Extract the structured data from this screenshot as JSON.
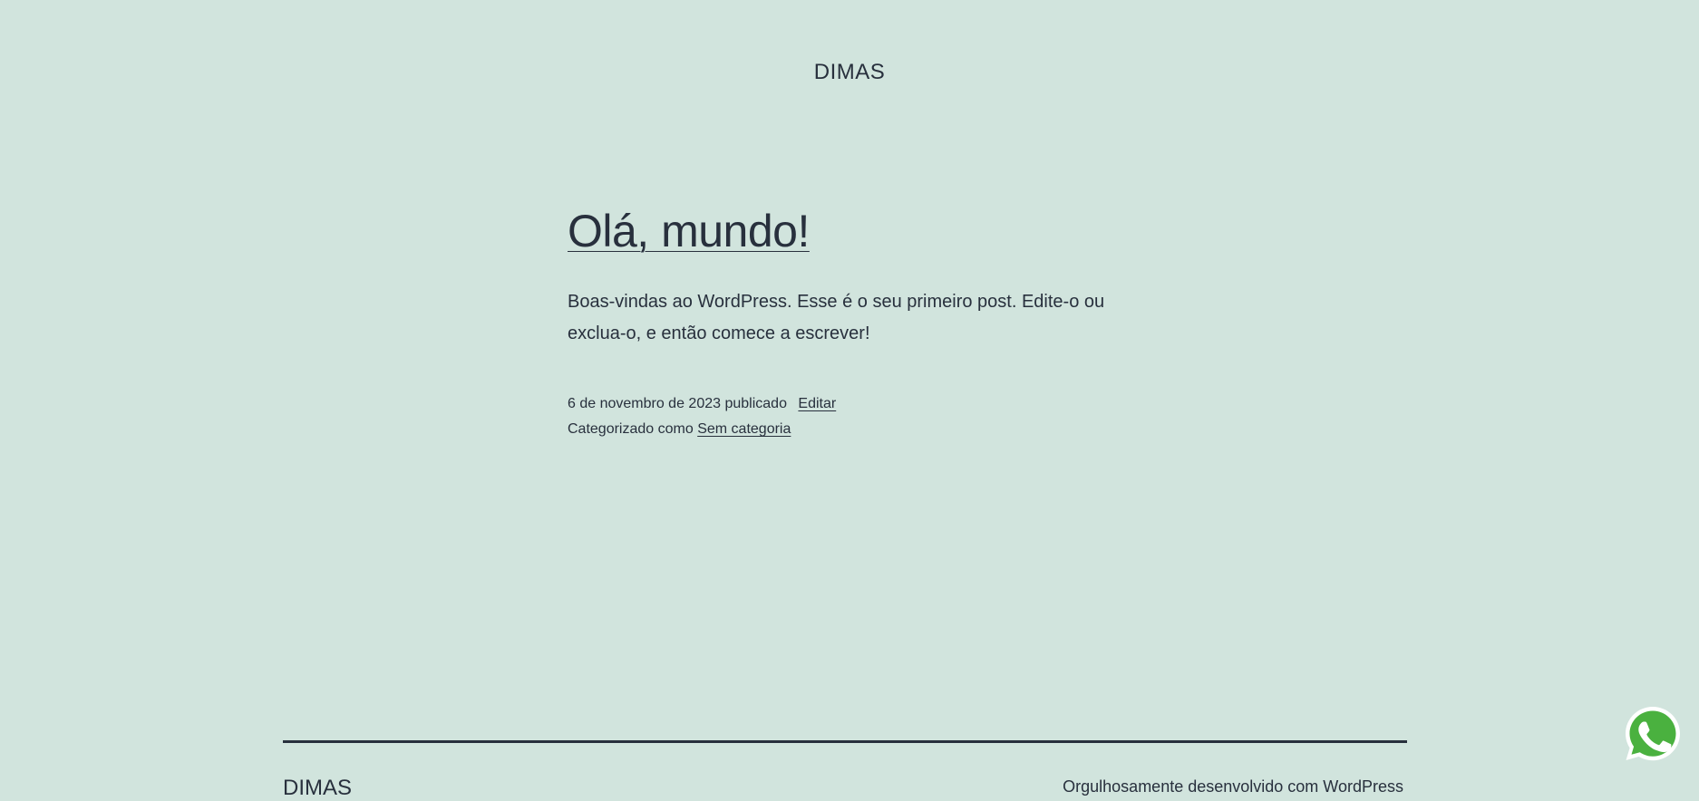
{
  "header": {
    "site_title": "DIMAS"
  },
  "post": {
    "title": "Olá, mundo!",
    "excerpt": "Boas-vindas ao WordPress. Esse é o seu primeiro post. Edite-o ou exclua-o, e então comece a escrever!",
    "published_text": "6 de novembro de 2023 publicado",
    "edit_label": "Editar",
    "categorized_prefix": "Categorizado como",
    "category": "Sem categoria"
  },
  "footer": {
    "site_title": "DIMAS",
    "credit": "Orgulhosamente desenvolvido com WordPress"
  },
  "icons": {
    "whatsapp": "whatsapp-icon"
  },
  "colors": {
    "background": "#d1e4dd",
    "text": "#28303d",
    "whatsapp_green": "#4ab13f"
  }
}
